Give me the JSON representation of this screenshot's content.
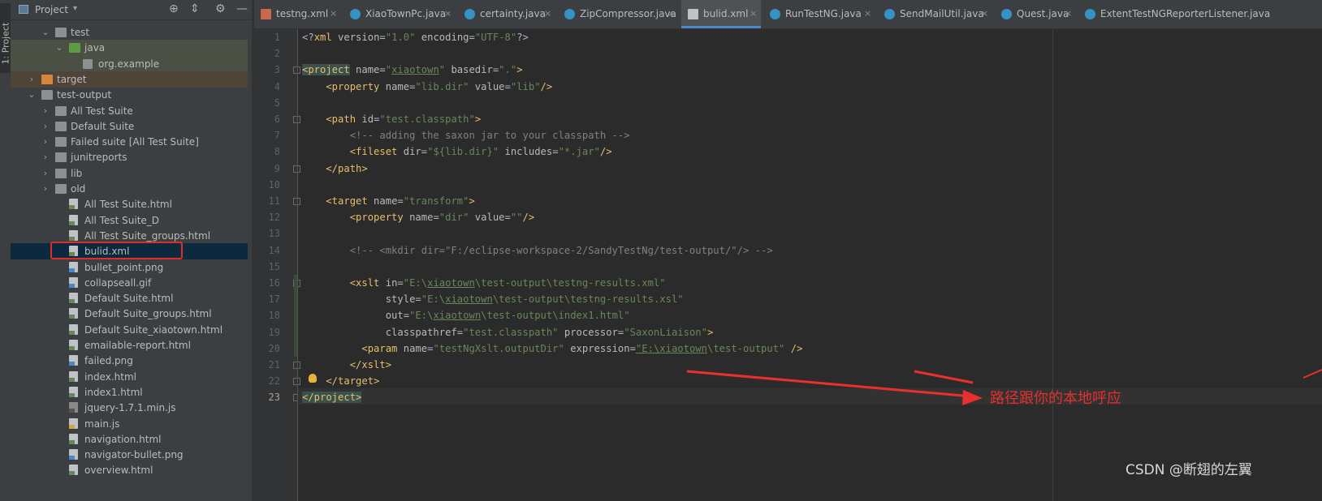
{
  "project_panel": {
    "side_tab_label": "1: Project",
    "title": "Project",
    "caret": "▾",
    "header_icons": [
      "target-icon",
      "collapse-icon",
      "gear-icon",
      "minimize-icon"
    ],
    "tree": [
      {
        "label": "test",
        "arrow": "⌄",
        "icon": "folder-gray"
      },
      {
        "label": "java",
        "arrow": "⌄",
        "icon": "folder-green"
      },
      {
        "label": "org.example",
        "arrow": "",
        "icon": "folder-pkg"
      },
      {
        "label": "target",
        "arrow": "›",
        "icon": "folder-orange"
      },
      {
        "label": "test-output",
        "arrow": "⌄",
        "icon": "folder-gray"
      },
      {
        "label": "All Test Suite",
        "arrow": "›",
        "icon": "folder-gray"
      },
      {
        "label": "Default Suite",
        "arrow": "›",
        "icon": "folder-gray"
      },
      {
        "label": "Failed suite [All Test Suite]",
        "arrow": "›",
        "icon": "folder-gray"
      },
      {
        "label": "junitreports",
        "arrow": "›",
        "icon": "folder-gray"
      },
      {
        "label": "lib",
        "arrow": "›",
        "icon": "folder-gray"
      },
      {
        "label": "old",
        "arrow": "›",
        "icon": "folder-gray"
      },
      {
        "label": "All Test Suite.html",
        "arrow": "",
        "icon": "file"
      },
      {
        "label": "All Test Suite_D",
        "arrow": "",
        "icon": "file"
      },
      {
        "label": "All Test Suite_groups.html",
        "arrow": "",
        "icon": "file"
      },
      {
        "label": "bulid.xml",
        "arrow": "",
        "icon": "file"
      },
      {
        "label": "bullet_point.png",
        "arrow": "",
        "icon": "file-img"
      },
      {
        "label": "collapseall.gif",
        "arrow": "",
        "icon": "file-img"
      },
      {
        "label": "Default Suite.html",
        "arrow": "",
        "icon": "file"
      },
      {
        "label": "Default Suite_groups.html",
        "arrow": "",
        "icon": "file"
      },
      {
        "label": "Default Suite_xiaotown.html",
        "arrow": "",
        "icon": "file"
      },
      {
        "label": "emailable-report.html",
        "arrow": "",
        "icon": "file"
      },
      {
        "label": "failed.png",
        "arrow": "",
        "icon": "file-img"
      },
      {
        "label": "index.html",
        "arrow": "",
        "icon": "file"
      },
      {
        "label": "index1.html",
        "arrow": "",
        "icon": "file"
      },
      {
        "label": "jquery-1.7.1.min.js",
        "arrow": "",
        "icon": "file-bin"
      },
      {
        "label": "main.js",
        "arrow": "",
        "icon": "file-js"
      },
      {
        "label": "navigation.html",
        "arrow": "",
        "icon": "file"
      },
      {
        "label": "navigator-bullet.png",
        "arrow": "",
        "icon": "file-img"
      },
      {
        "label": "overview.html",
        "arrow": "",
        "icon": "file"
      }
    ]
  },
  "tabs": [
    {
      "label": "testng.xml",
      "icon": "xmlred"
    },
    {
      "label": "XiaoTownPc.java",
      "icon": "class"
    },
    {
      "label": "certainty.java",
      "icon": "class"
    },
    {
      "label": "ZipCompressor.java",
      "icon": "class"
    },
    {
      "label": "bulid.xml",
      "icon": "xml",
      "active": true
    },
    {
      "label": "RunTestNG.java",
      "icon": "class"
    },
    {
      "label": "SendMailUtil.java",
      "icon": "class"
    },
    {
      "label": "Quest.java",
      "icon": "class"
    },
    {
      "label": "ExtentTestNGReporterListener.java",
      "icon": "class"
    }
  ],
  "tab_close": "×",
  "editor": {
    "line_numbers": [
      "1",
      "2",
      "3",
      "4",
      "5",
      "6",
      "7",
      "8",
      "9",
      "10",
      "11",
      "12",
      "13",
      "14",
      "15",
      "16",
      "17",
      "18",
      "19",
      "20",
      "21",
      "22",
      "23"
    ],
    "current_line": 23,
    "lines": [
      [
        [
          "pl",
          "<?"
        ],
        [
          "tg",
          "xml "
        ],
        [
          "at",
          "version"
        ],
        [
          "pl",
          "="
        ],
        [
          "st",
          "\"1.0\""
        ],
        [
          "at",
          " encoding"
        ],
        [
          "pl",
          "="
        ],
        [
          "st",
          "\"UTF-8\""
        ],
        [
          "pl",
          "?>"
        ]
      ],
      [],
      [
        [
          "hl",
          "<project"
        ],
        [
          "at",
          " name"
        ],
        [
          "pl",
          "="
        ],
        [
          "st",
          "\""
        ],
        [
          "stsq",
          "xiaotown"
        ],
        [
          "st",
          "\""
        ],
        [
          "at",
          " basedir"
        ],
        [
          "pl",
          "="
        ],
        [
          "st",
          "\".\""
        ],
        [
          "tg",
          ">"
        ]
      ],
      [
        [
          "tg",
          "    <property"
        ],
        [
          "at",
          " name"
        ],
        [
          "pl",
          "="
        ],
        [
          "st",
          "\"lib.dir\""
        ],
        [
          "at",
          " value"
        ],
        [
          "pl",
          "="
        ],
        [
          "st",
          "\"lib\""
        ],
        [
          "tg",
          "/>"
        ]
      ],
      [],
      [
        [
          "tg",
          "    <path"
        ],
        [
          "at",
          " id"
        ],
        [
          "pl",
          "="
        ],
        [
          "st",
          "\"test.classpath\""
        ],
        [
          "tg",
          ">"
        ]
      ],
      [
        [
          "cm",
          "        <!-- adding the saxon jar to your classpath -->"
        ]
      ],
      [
        [
          "tg",
          "        <fileset"
        ],
        [
          "at",
          " dir"
        ],
        [
          "pl",
          "="
        ],
        [
          "st",
          "\"${lib.dir}\""
        ],
        [
          "at",
          " includes"
        ],
        [
          "pl",
          "="
        ],
        [
          "st",
          "\"*.jar\""
        ],
        [
          "tg",
          "/>"
        ]
      ],
      [
        [
          "tg",
          "    </path>"
        ]
      ],
      [],
      [
        [
          "tg",
          "    <target"
        ],
        [
          "at",
          " name"
        ],
        [
          "pl",
          "="
        ],
        [
          "st",
          "\"transform\""
        ],
        [
          "tg",
          ">"
        ]
      ],
      [
        [
          "tg",
          "        <property"
        ],
        [
          "at",
          " name"
        ],
        [
          "pl",
          "="
        ],
        [
          "st",
          "\"dir\""
        ],
        [
          "at",
          " value"
        ],
        [
          "pl",
          "="
        ],
        [
          "st",
          "\"\""
        ],
        [
          "tg",
          "/>"
        ]
      ],
      [],
      [
        [
          "cm",
          "        <!-- <mkdir dir=\"F:/eclipse-workspace-2/SandyTestNg/test-output/\"/> -->"
        ]
      ],
      [],
      [
        [
          "tg",
          "        <xslt"
        ],
        [
          "at",
          " in"
        ],
        [
          "pl",
          "="
        ],
        [
          "st",
          "\"E:\\"
        ],
        [
          "stsq",
          "xiaotown"
        ],
        [
          "st",
          "\\test-output\\testng-results.xml\""
        ]
      ],
      [
        [
          "at",
          "              style"
        ],
        [
          "pl",
          "="
        ],
        [
          "st",
          "\"E:\\"
        ],
        [
          "stsq",
          "xiaotown"
        ],
        [
          "st",
          "\\test-output\\testng-results.xsl\""
        ]
      ],
      [
        [
          "at",
          "              out"
        ],
        [
          "pl",
          "="
        ],
        [
          "st",
          "\"E:\\"
        ],
        [
          "stsq",
          "xiaotown"
        ],
        [
          "st",
          "\\test-output\\index1.html\""
        ]
      ],
      [
        [
          "at",
          "              classpathref"
        ],
        [
          "pl",
          "="
        ],
        [
          "st",
          "\"test.classpath\""
        ],
        [
          "at",
          " processor"
        ],
        [
          "pl",
          "="
        ],
        [
          "st",
          "\"SaxonLiaison\""
        ],
        [
          "tg",
          ">"
        ]
      ],
      [
        [
          "tg",
          "          <param"
        ],
        [
          "at",
          " name"
        ],
        [
          "pl",
          "="
        ],
        [
          "st",
          "\"testNgXslt.outputDir\""
        ],
        [
          "at",
          " expression"
        ],
        [
          "pl",
          "="
        ],
        [
          "stsq",
          "\"E:\\xiaotown"
        ],
        [
          "st",
          "\\test-output\""
        ],
        [
          "tg",
          " />"
        ]
      ],
      [
        [
          "tg",
          "        </xslt>"
        ]
      ],
      [
        [
          "tg",
          "    </target>"
        ]
      ],
      [
        [
          "hl",
          "</project>"
        ]
      ]
    ]
  },
  "annotation_text": "路径跟你的本地呼应",
  "watermark": "CSDN @断翅的左翼",
  "colors": {
    "arrow": "#e8302c",
    "selection": "#0d293e"
  }
}
